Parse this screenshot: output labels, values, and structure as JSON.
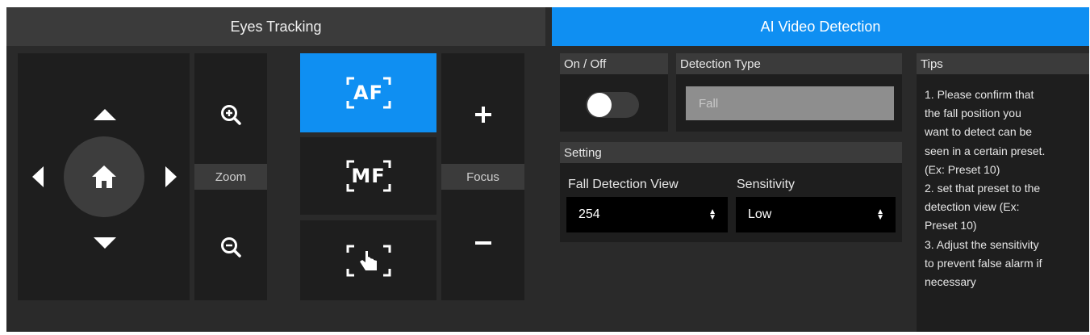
{
  "tabs": {
    "eyes_tracking": "Eyes Tracking",
    "ai_video_detection": "AI Video Detection"
  },
  "controls": {
    "zoom_label": "Zoom",
    "focus_label": "Focus",
    "af_label": "AF",
    "mf_label": "MF"
  },
  "detection": {
    "onoff_label": "On / Off",
    "toggle_on": false,
    "type_label": "Detection Type",
    "type_value": "Fall",
    "setting_label": "Setting",
    "view_label": "Fall Detection View",
    "view_value": "254",
    "sensitivity_label": "Sensitivity",
    "sensitivity_value": "Low"
  },
  "tips": {
    "title": "Tips",
    "lines": [
      "1. Please confirm that",
      "the fall position you",
      "want to detect can be",
      "seen in a certain preset.",
      "(Ex: Preset 10)",
      "2. set that preset to the",
      "detection view (Ex:",
      "Preset 10)",
      "3. Adjust the sensitivity",
      "to prevent false alarm if",
      "necessary"
    ]
  },
  "colors": {
    "accent": "#0f8ff2",
    "panel": "#1e1e1e",
    "header": "#3b3b3b"
  }
}
